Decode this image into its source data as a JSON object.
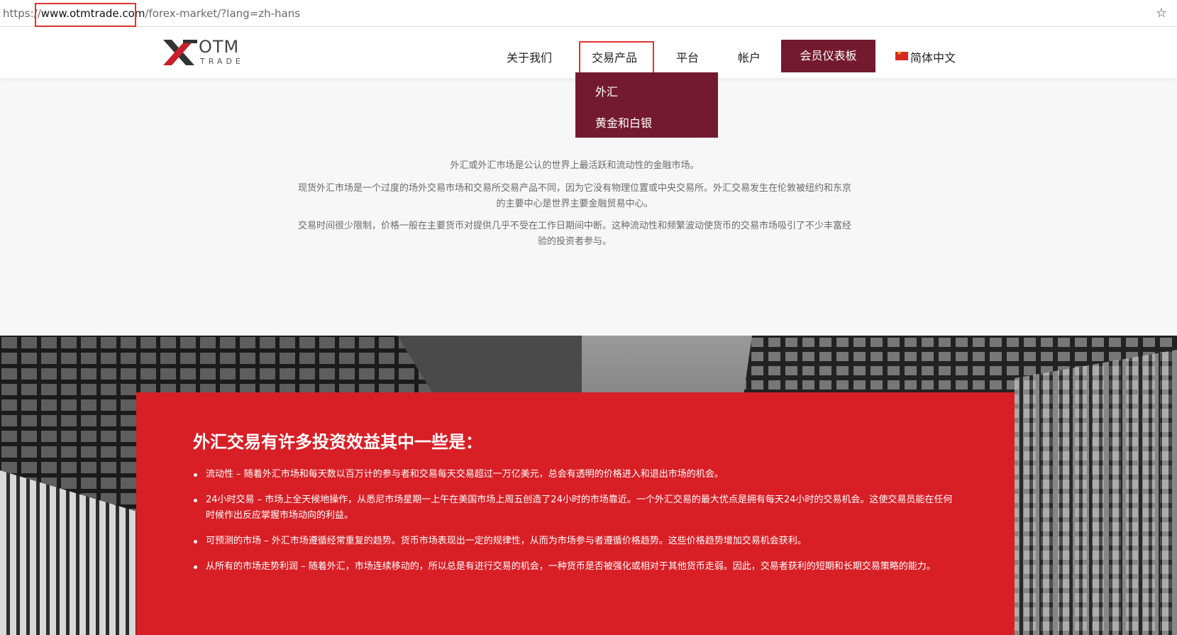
{
  "browser": {
    "url_scheme": "https://",
    "url_host": "www.otmtrade.com",
    "url_path": "/forex-market/?lang=zh-hans"
  },
  "logo": {
    "name": "OTM",
    "sub": "TRADE"
  },
  "nav": {
    "items": [
      "关于我们",
      "交易产品",
      "平台",
      "帐户"
    ],
    "member_button": "会员仪表板",
    "language": "简体中文"
  },
  "dropdown": {
    "items": [
      "外汇",
      "黄金和白银"
    ]
  },
  "intro": {
    "p1": "外汇或外汇市场是公认的世界上最活跃和流动性的金融市场。",
    "p2": "现货外汇市场是一个过度的场外交易市场和交易所交易产品不同，因为它没有物理位置或中央交易所。外汇交易发生在伦敦被纽约和东京的主要中心是世界主要金融贸易中心。",
    "p3": "交易时间很少限制，价格一般在主要货币对提供几乎不受在工作日期间中断。这种流动性和频繁波动使货币的交易市场吸引了不少丰富经验的投资者参与。"
  },
  "benefits": {
    "title": "外汇交易有许多投资效益其中一些是：",
    "items": [
      "流动性 – 随着外汇市场和每天数以百万计的参与者和交易每天交易超过一万亿美元，总会有透明的价格进入和退出市场的机会。",
      "24小时交易 – 市场上全天候地操作，从悉尼市场星期一上午在美国市场上周五创造了24小时的市场靠近。一个外汇交易的最大优点是拥有每天24小时的交易机会。这使交易员能在任何时候作出反应掌握市场动向的利益。",
      "可预测的市场 – 外汇市场遵循经常重复的趋势。货币市场表现出一定的规律性，从而为市场参与者遵循价格趋势。这些价格趋势增加交易机会获利。",
      "从所有的市场走势利润 – 随着外汇，市场连续移动的，所以总是有进行交易的机会，一种货币是否被强化或相对于其他货币走弱。因此，交易者获利的短期和长期交易策略的能力。"
    ]
  },
  "colors": {
    "accent_maroon": "#731a30",
    "benefit_red": "#d81f26",
    "highlight_red": "#e0352b"
  },
  "icons": {
    "bookmark": "star-icon",
    "flag": "china-flag-icon",
    "logo": "otm-x-logo-icon"
  }
}
